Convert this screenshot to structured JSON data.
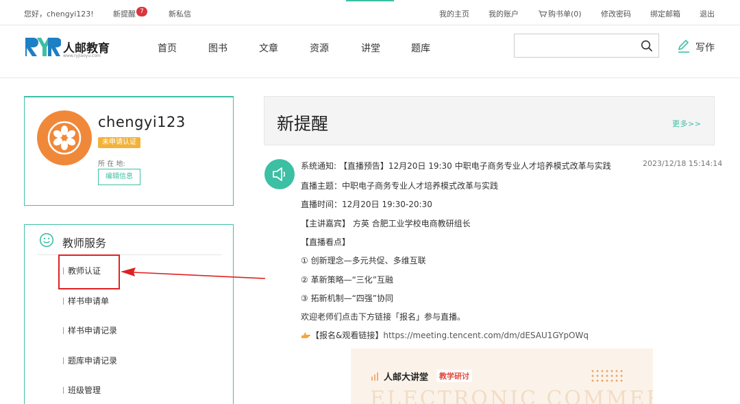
{
  "topbar": {
    "greeting": "您好，chengyi123!",
    "new_reminder": "新提醒",
    "reminder_count": "7",
    "new_message": "新私信",
    "my_home": "我的主页",
    "my_account": "我的账户",
    "cart": "购书单(0)",
    "change_password": "修改密码",
    "bind_email": "绑定邮箱",
    "logout": "退出"
  },
  "header": {
    "brand": "人邮教育",
    "brand_url": "www.ryjiaoyu.com",
    "nav": [
      "首页",
      "图书",
      "文章",
      "资源",
      "讲堂",
      "题库"
    ],
    "search_placeholder": "",
    "write": "写作"
  },
  "profile": {
    "username": "chengyi123",
    "cert_status": "未申请认证",
    "location_label": "所 在 地:",
    "edit_button": "编辑信息"
  },
  "teacher_service": {
    "title": "教师服务",
    "items": [
      "教师认证",
      "样书申请单",
      "样书申请记录",
      "题库申请记录",
      "班级管理"
    ]
  },
  "notices": {
    "title": "新提醒",
    "more": "更多>>",
    "message": {
      "date": "2023/12/18 15:14:14",
      "lines": [
        "系统通知: 【直播预告】12月20日 19:30 中职电子商务专业人才培养模式改革与实践",
        "直播主题：中职电子商务专业人才培养模式改革与实践",
        "直播时间：12月20日 19:30-20:30",
        "【主讲嘉宾】 方英 合肥工业学校电商教研组长",
        "【直播看点】",
        "① 创新理念—多元共促、多维互联",
        "② 革新策略—“三化”互融",
        "③ 拓新机制—“四强”协同",
        "欢迎老师们点击下方链接「报名」参与直播。"
      ],
      "link_label": "【报名&观看链接】",
      "link_url": "https://meeting.tencent.com/dm/dESAU1GYpOWq"
    },
    "poster": {
      "title": "人邮大讲堂",
      "tag": "教学研讨",
      "watermark": "ELECTRONIC COMMERCE"
    }
  },
  "colors": {
    "accent": "#3cbfa3",
    "avatar": "#f0883a",
    "badge": "#d9363e",
    "cert_badge": "#f2b23a",
    "annotation": "#e02020"
  }
}
